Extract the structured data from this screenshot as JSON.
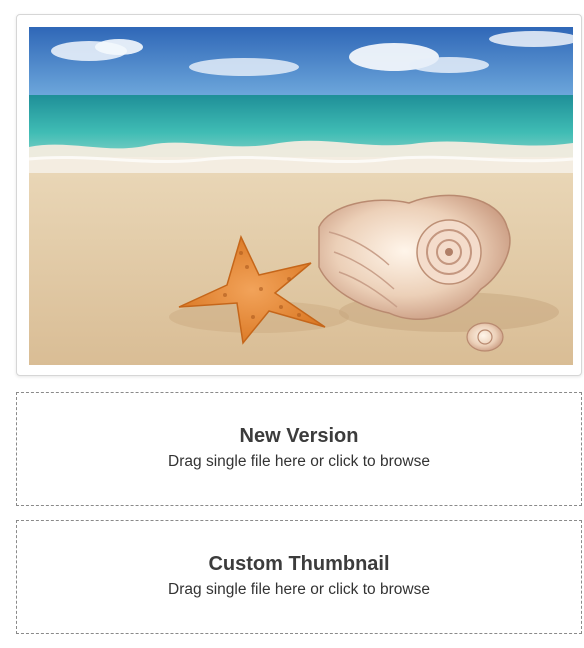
{
  "preview": {
    "image_alt": "Starfish and seashells on a sandy beach"
  },
  "new_version": {
    "title": "New Version",
    "subtitle": "Drag single file here or click to browse"
  },
  "custom_thumbnail": {
    "title": "Custom Thumbnail",
    "subtitle": "Drag single file here or click to browse"
  },
  "colors": {
    "dropzone_border": "#8a8a8a",
    "title_text": "#3c3c3c",
    "subtitle_text": "#333333"
  }
}
